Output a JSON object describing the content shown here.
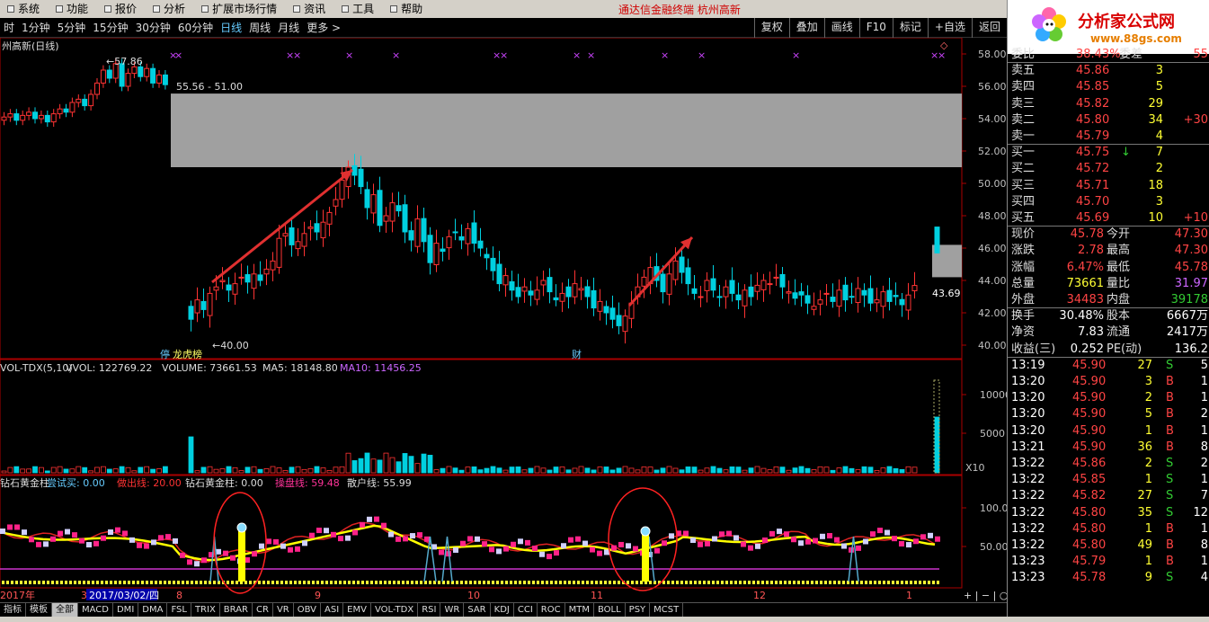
{
  "menu": {
    "items": [
      "系统",
      "功能",
      "报价",
      "分析",
      "扩展市场行情",
      "资讯",
      "工具",
      "帮助"
    ],
    "center_title": "通达信金融终端   杭州高新"
  },
  "periods": [
    "1分钟",
    "5分钟",
    "15分钟",
    "30分钟",
    "60分钟",
    "日线",
    "周线",
    "月线",
    "更多 >"
  ],
  "period_first": "时",
  "active_period": "日线",
  "toolbar": [
    "复权",
    "叠加",
    "画线",
    "F10",
    "标记",
    "+自选",
    "返回"
  ],
  "chart": {
    "title": "州高新(日线)",
    "high_label": "57.86",
    "range_label": "55.56 - 51.00",
    "low_label": "40.00",
    "last_price_label": "43.69",
    "tag_left": "停",
    "tag_left2": "龙虎榜",
    "tag_mid": "财",
    "price_ticks": [
      "58.00",
      "56.00",
      "54.00",
      "52.00",
      "50.00",
      "48.00",
      "46.00",
      "44.00",
      "42.00",
      "40.00"
    ],
    "volume_ticks": [
      "10000",
      "5000"
    ],
    "volume_unit": "X10",
    "indicator_ticks": [
      "100.0",
      "50.00"
    ],
    "vol_legend": {
      "name": "VOL-TDX(5,10)",
      "vvol": "VVOL: 122769.22",
      "volume": "VOLUME: 73661.53",
      "ma5": "MA5: 18148.80",
      "ma10": "MA10: 11456.25"
    },
    "ind_legend": {
      "name": "钻石黄金柱",
      "l1": "尝试买: 0.00",
      "l2": "做出线: 20.00",
      "l3": "钻石黄金柱: 0.00",
      "l4": "操盘线: 59.48",
      "l5": "散户线: 55.99"
    },
    "date_labels": [
      "2017年",
      "3",
      "2017/03/02/四",
      "8",
      "9",
      "10",
      "11",
      "12",
      "1"
    ],
    "colors": {
      "up": "#ff3333",
      "down": "#00d0e0",
      "box": "#a0a0a0",
      "arrow": "#e03030"
    }
  },
  "tabs": [
    "指标",
    "模板",
    "全部",
    "MACD",
    "DMI",
    "DMA",
    "FSL",
    "TRIX",
    "BRAR",
    "CR",
    "VR",
    "OBV",
    "ASI",
    "EMV",
    "VOL-TDX",
    "RSI",
    "WR",
    "SAR",
    "KDJ",
    "CCI",
    "ROC",
    "MTM",
    "BOLL",
    "PSY",
    "MCST"
  ],
  "active_tab": "全部",
  "logo": {
    "brand": "分析家公式网",
    "url": "www.88gs.com"
  },
  "order_book": {
    "header": {
      "l1": "委比",
      "v1": "38.43%",
      "l2": "委差",
      "v2": "55"
    },
    "asks": [
      {
        "label": "卖五",
        "price": "45.86",
        "vol": "3",
        "chg": ""
      },
      {
        "label": "卖四",
        "price": "45.85",
        "vol": "5",
        "chg": ""
      },
      {
        "label": "卖三",
        "price": "45.82",
        "vol": "29",
        "chg": ""
      },
      {
        "label": "卖二",
        "price": "45.80",
        "vol": "34",
        "chg": "+30"
      },
      {
        "label": "卖一",
        "price": "45.79",
        "vol": "4",
        "chg": ""
      }
    ],
    "bids": [
      {
        "label": "买一",
        "price": "45.75",
        "vol": "7",
        "chg": ""
      },
      {
        "label": "买二",
        "price": "45.72",
        "vol": "2",
        "chg": ""
      },
      {
        "label": "买三",
        "price": "45.71",
        "vol": "18",
        "chg": ""
      },
      {
        "label": "买四",
        "price": "45.70",
        "vol": "3",
        "chg": ""
      },
      {
        "label": "买五",
        "price": "45.69",
        "vol": "10",
        "chg": "+10"
      }
    ]
  },
  "stats": [
    {
      "l1": "现价",
      "v1": "45.78",
      "l2": "今开",
      "v2": "47.30"
    },
    {
      "l1": "涨跌",
      "v1": "2.78",
      "l2": "最高",
      "v2": "47.30"
    },
    {
      "l1": "涨幅",
      "v1": "6.47%",
      "l2": "最低",
      "v2": "45.78"
    },
    {
      "l1": "总量",
      "v1": "73661",
      "l2": "量比",
      "v2": "31.97"
    },
    {
      "l1": "外盘",
      "v1": "34483",
      "l2": "内盘",
      "v2": "39178"
    },
    {
      "l1": "换手",
      "v1": "30.48%",
      "l2": "股本",
      "v2": "6667万"
    },
    {
      "l1": "净资",
      "v1": "7.83",
      "l2": "流通",
      "v2": "2417万"
    },
    {
      "l1": "收益(三)",
      "v1": "0.252",
      "l2": "PE(动)",
      "v2": "136.2"
    }
  ],
  "ticks": [
    {
      "time": "13:19",
      "price": "45.90",
      "vol": "27",
      "side": "S",
      "n": "5"
    },
    {
      "time": "13:20",
      "price": "45.90",
      "vol": "3",
      "side": "B",
      "n": "1"
    },
    {
      "time": "13:20",
      "price": "45.90",
      "vol": "2",
      "side": "B",
      "n": "1"
    },
    {
      "time": "13:20",
      "price": "45.90",
      "vol": "5",
      "side": "B",
      "n": "2"
    },
    {
      "time": "13:20",
      "price": "45.90",
      "vol": "1",
      "side": "B",
      "n": "1"
    },
    {
      "time": "13:21",
      "price": "45.90",
      "vol": "36",
      "side": "B",
      "n": "8"
    },
    {
      "time": "13:22",
      "price": "45.86",
      "vol": "2",
      "side": "S",
      "n": "2"
    },
    {
      "time": "13:22",
      "price": "45.85",
      "vol": "1",
      "side": "S",
      "n": "1"
    },
    {
      "time": "13:22",
      "price": "45.82",
      "vol": "27",
      "side": "S",
      "n": "7"
    },
    {
      "time": "13:22",
      "price": "45.80",
      "vol": "35",
      "side": "S",
      "n": "12"
    },
    {
      "time": "13:22",
      "price": "45.80",
      "vol": "1",
      "side": "B",
      "n": "1"
    },
    {
      "time": "13:22",
      "price": "45.80",
      "vol": "49",
      "side": "B",
      "n": "8"
    },
    {
      "time": "13:23",
      "price": "45.79",
      "vol": "1",
      "side": "B",
      "n": "1"
    },
    {
      "time": "13:23",
      "price": "45.78",
      "vol": "9",
      "side": "S",
      "n": "4"
    }
  ]
}
